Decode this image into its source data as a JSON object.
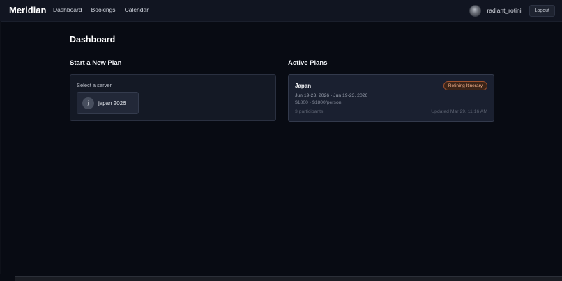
{
  "header": {
    "brand": "Meridian",
    "nav": [
      "Dashboard",
      "Bookings",
      "Calendar"
    ],
    "username": "radiant_rotini",
    "logout_label": "Logout"
  },
  "main": {
    "title": "Dashboard",
    "new_plan": {
      "heading": "Start a New Plan",
      "select_label": "Select a server",
      "servers": [
        {
          "initial": "j",
          "name": "japan 2026"
        }
      ]
    },
    "active_plans": {
      "heading": "Active Plans",
      "plans": [
        {
          "name": "Japan",
          "status": "Refining Itinerary",
          "dates": "Jun 19-23, 2026 - Jun 19-23, 2026",
          "price": "$1800 - $1800/person",
          "participants": "3 participants",
          "updated": "Updated Mar 29, 11:16 AM"
        }
      ]
    }
  },
  "colors": {
    "background": "#080b13",
    "topbar": "#111521",
    "card": "#141925",
    "status_accent": "#a0522d"
  },
  "icons": {
    "avatar": "user-avatar",
    "server": "server-initial-icon"
  }
}
